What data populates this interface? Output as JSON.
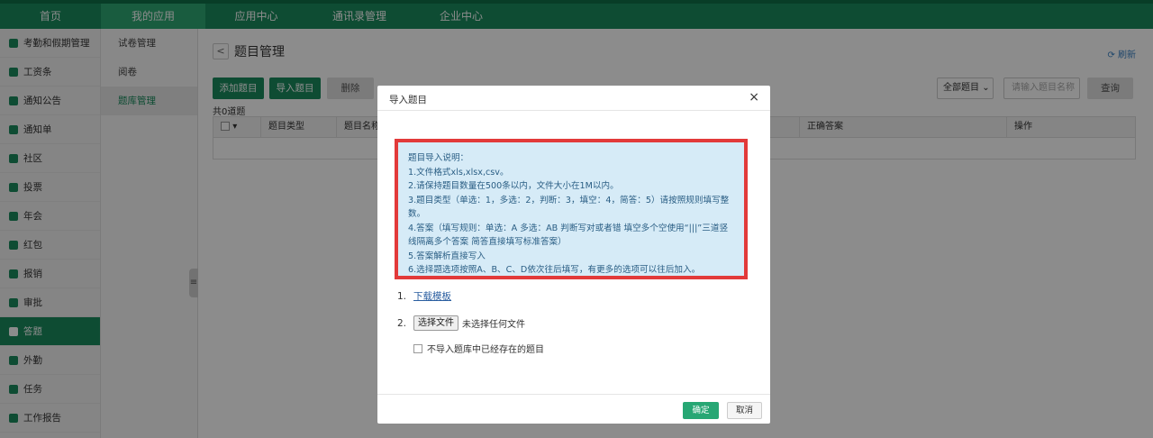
{
  "topnav": {
    "items": [
      "首页",
      "我的应用",
      "应用中心",
      "通讯录管理",
      "企业中心"
    ]
  },
  "sidebar": {
    "items": [
      "考勤和假期管理",
      "工资条",
      "通知公告",
      "通知单",
      "社区",
      "投票",
      "年会",
      "红包",
      "报销",
      "审批",
      "答题",
      "外勤",
      "任务",
      "工作报告"
    ]
  },
  "subnav": {
    "items": [
      "试卷管理",
      "阅卷",
      "题库管理"
    ]
  },
  "main": {
    "title": "题目管理",
    "refresh": "刷新",
    "buttons": {
      "add": "添加题目",
      "import": "导入题目",
      "delete": "删除",
      "search": "查询"
    },
    "filter_value": "全部题目",
    "search_placeholder": "请输入题目名称",
    "count": "共0道题",
    "columns": [
      "题目类型",
      "题目名称",
      "正确答案",
      "操作"
    ]
  },
  "modal": {
    "title": "导入题目",
    "close": "×",
    "info_lines": [
      "题目导入说明：",
      "1.文件格式xls,xlsx,csv。",
      "2.请保持题目数量在500条以内，文件大小在1M以内。",
      "3.题目类型（单选：1，多选：2，判断：3，填空：4，简答：5）请按照规则填写整数。",
      "4.答案（填写规则：单选：A 多选：AB 判断写对或者错 填空多个空使用“|||”三道竖线隔离多个答案 简答直接填写标准答案）",
      "5.答案解析直接写入",
      "6.选择题选项按照A、B、C、D依次往后填写，有更多的选项可以往后加入。"
    ],
    "step1_num": "1.",
    "step1_link": "下载模板",
    "step2_num": "2.",
    "file_button": "选择文件",
    "file_status": "未选择任何文件",
    "checkbox_label": "不导入题库中已经存在的题目",
    "ok": "确定",
    "cancel": "取消"
  },
  "colors": {
    "brand": "#1a8a5d",
    "info_bg": "#d6ebf7",
    "highlight": "#e23a3a"
  }
}
